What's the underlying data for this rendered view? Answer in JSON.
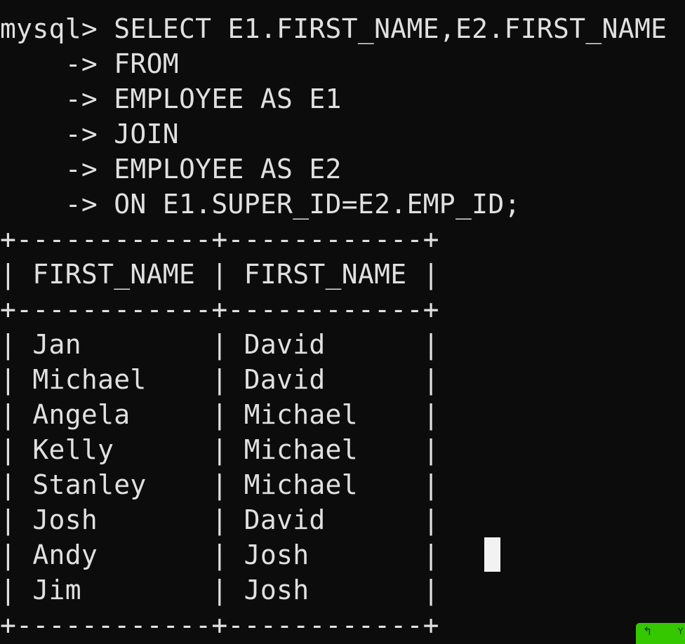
{
  "terminal": {
    "query_lines": [
      "mysql> SELECT E1.FIRST_NAME,E2.FIRST_NAME",
      "    -> FROM",
      "    -> EMPLOYEE AS E1",
      "    -> JOIN",
      "    -> EMPLOYEE AS E2",
      "    -> ON E1.SUPER_ID=E2.EMP_ID;"
    ],
    "result_lines": [
      "+------------+------------+",
      "| FIRST_NAME | FIRST_NAME |",
      "+------------+------------+",
      "| Jan        | David      |",
      "| Michael    | David      |",
      "| Angela     | Michael    |",
      "| Kelly      | Michael    |",
      "| Stanley    | Michael    |",
      "| Josh       | David      |",
      "| Andy       | Josh       |",
      "| Jim        | Josh       |",
      "+------------+------------+"
    ]
  },
  "overlay": {
    "badge_icon": "↰",
    "badge_text": "Y"
  },
  "colors": {
    "background": "#0c0c0c",
    "text": "#e0e0e0",
    "cursor": "#f2f2f2",
    "badge": "#35c700"
  }
}
